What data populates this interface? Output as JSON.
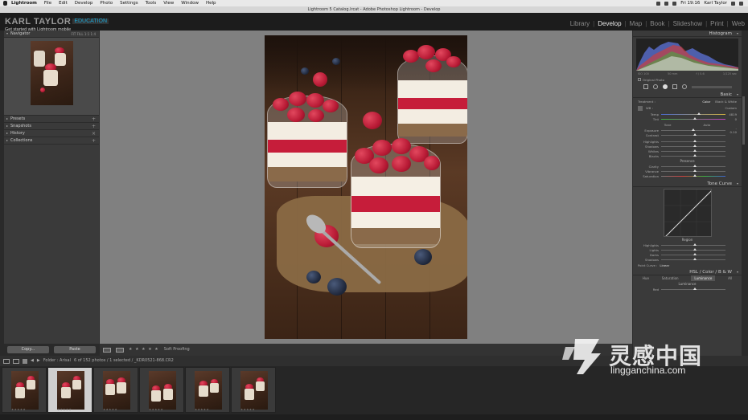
{
  "menubar": {
    "items": [
      "Lightroom",
      "File",
      "Edit",
      "Develop",
      "Photo",
      "Settings",
      "Tools",
      "View",
      "Window",
      "Help"
    ],
    "clock": "Fri 19:16",
    "user": "Karl Taylor"
  },
  "window_title": "Lightroom 5 Catalog.lrcat - Adobe Photoshop Lightroom - Develop",
  "identity": {
    "name": "KARL TAYLOR",
    "edu": "EDUCATION",
    "subtitle": "Get started with Lightroom mobile"
  },
  "modules": [
    "Library",
    "Develop",
    "Map",
    "Book",
    "Slideshow",
    "Print",
    "Web"
  ],
  "active_module": "Develop",
  "left_panel": {
    "navigator": "Navigator",
    "nav_opts": "FIT  FILL  1:1  1:4",
    "sections": [
      "Presets",
      "Snapshots",
      "History",
      "Collections"
    ],
    "copy_button": "Copy...",
    "paste_button": "Paste"
  },
  "toolbar": {
    "stars": "★ ★ ★ ★ ★",
    "soft_proof": "Soft Proofing"
  },
  "right_panel": {
    "histogram": "Histogram",
    "hist_info": [
      "ISO 100",
      "50 mm",
      "f / 5.6",
      "1/125 sec"
    ],
    "original_photo": "Original Photo",
    "basic": "Basic",
    "treatment": "Treatment :",
    "color": "Color",
    "bw": "Black & White",
    "wb_label": "WB :",
    "wb_value": "Custom",
    "temp": "Temp",
    "temp_val": "4819",
    "tint": "Tint",
    "tint_val": "0",
    "tone": "Tone",
    "auto": "Auto",
    "exposure": "Exposure",
    "exposure_val": "- 0.10",
    "contrast": "Contrast",
    "highlights": "Highlights",
    "shadows": "Shadows",
    "whites": "Whites",
    "blacks": "Blacks",
    "presence": "Presence",
    "clarity": "Clarity",
    "vibrance": "Vibrance",
    "saturation": "Saturation",
    "tone_curve": "Tone Curve",
    "region": "Region",
    "tc_highlights": "Highlights",
    "tc_lights": "Lights",
    "tc_darks": "Darks",
    "tc_shadows": "Shadows",
    "point_curve": "Point Curve :",
    "point_curve_val": "Linear",
    "hsl_tabs": "HSL  /  Color  /  B & W",
    "hsl_sub": [
      "Hue",
      "Saturation",
      "Luminance",
      "All"
    ],
    "luminance": "Luminance",
    "red": "Red"
  },
  "filmstrip": {
    "folder": "Folder : Arisal",
    "count": "6 of 152 photos / 1 selected / _KDR0521-868.CR2",
    "thumb_stars": "★★★★★",
    "selected_index": 1
  },
  "watermark": {
    "cn": "灵感中国",
    "en": "lingganchina.com"
  }
}
